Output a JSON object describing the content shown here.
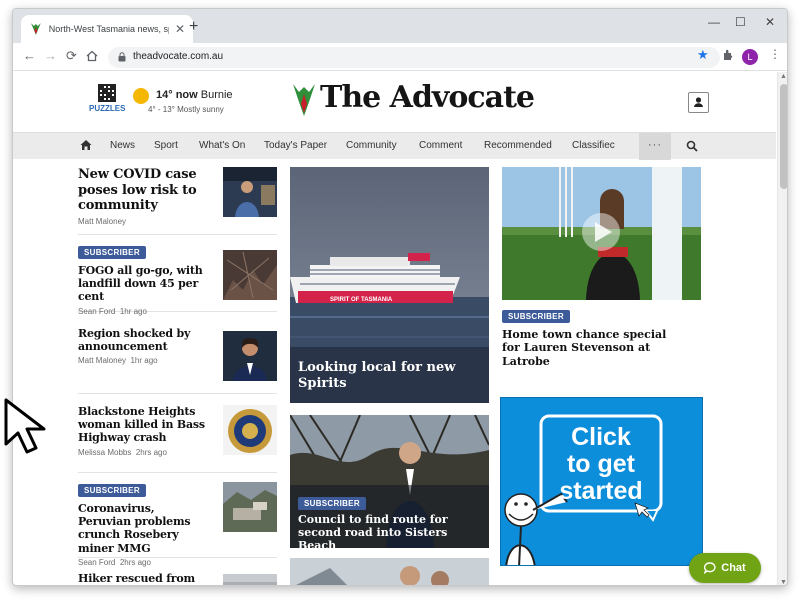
{
  "browser": {
    "tab_title": "North-West Tasmania news, spor",
    "tab_close": "✕",
    "new_tab": "+",
    "url": "theadvocate.com.au",
    "profile_initial": "L",
    "controls": {
      "minimize": "—",
      "maximize": "☐",
      "close": "✕"
    },
    "nav": {
      "back": "←",
      "forward": "→",
      "reload": "⟳"
    }
  },
  "header": {
    "puzzles_label": "PUZZLES",
    "weather_temp": "14° now",
    "weather_place": "Burnie",
    "weather_range": "4° - 13° Mostly sunny",
    "logo_text": "The Advocate"
  },
  "nav": {
    "items": [
      "News",
      "Sport",
      "What's On",
      "Today's Paper",
      "Community",
      "Comment",
      "Recommended",
      "Classifiec"
    ],
    "more": "···"
  },
  "left_stories": [
    {
      "title": "New COVID case poses low risk to community",
      "author": "Matt Maloney",
      "time": "",
      "badge": ""
    },
    {
      "title": "FOGO all go-go, with landfill down 45 per cent",
      "author": "Sean Ford",
      "time": "1hr ago",
      "badge": "SUBSCRIBER"
    },
    {
      "title": "Region shocked by announcement",
      "author": "Matt Maloney",
      "time": "1hr ago",
      "badge": ""
    },
    {
      "title": "Blackstone Heights woman killed in Bass Highway crash",
      "author": "Melissa Mobbs",
      "time": "2hrs ago",
      "badge": ""
    },
    {
      "title": "Coronavirus, Peruvian problems crunch Rosebery miner MMG",
      "author": "Sean Ford",
      "time": "2hrs ago",
      "badge": "SUBSCRIBER"
    },
    {
      "title": "Hiker rescued from",
      "author": "",
      "time": "",
      "badge": ""
    }
  ],
  "mid_stories": [
    {
      "title": "Looking local for new Spirits",
      "ship_name": "SPIRIT OF TASMANIA"
    },
    {
      "title": "Council to find route for second road into Sisters Beach",
      "badge": "SUBSCRIBER"
    }
  ],
  "right_story": {
    "badge": "SUBSCRIBER",
    "title": "Home town chance special for Lauren Stevenson at Latrobe"
  },
  "ad": {
    "line1": "Click",
    "line2": "to get",
    "line3": "started"
  },
  "chat": {
    "label": "Chat"
  },
  "colors": {
    "badge": "#3d5a99",
    "chat": "#71a414",
    "ad_bg": "#0d8edb",
    "sun": "#f5b800"
  }
}
